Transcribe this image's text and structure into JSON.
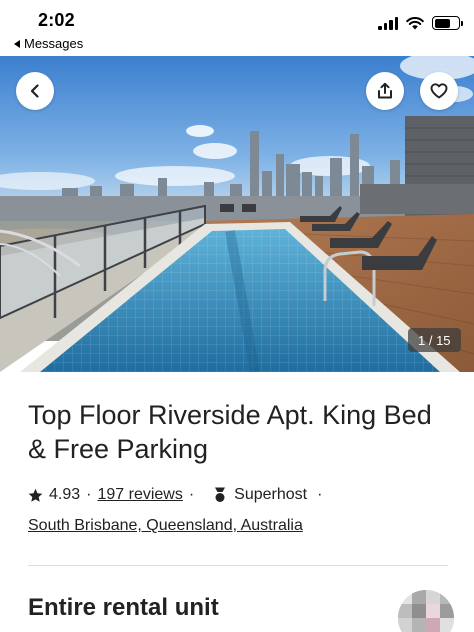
{
  "status_bar": {
    "time": "2:02",
    "back_label": "Messages"
  },
  "gallery": {
    "counter": "1 / 15",
    "image_icon": "rooftop-pool-photo",
    "back_icon": "chevron-left-icon",
    "share_icon": "share-icon",
    "save_icon": "heart-icon"
  },
  "listing": {
    "title": "Top Floor Riverside Apt. King Bed & Free Parking",
    "rating": "4.93",
    "separator": "·",
    "reviews": "197 reviews",
    "badge": "Superhost",
    "trailing_dot": "·",
    "location": "South Brisbane, Queensland, Australia",
    "subtitle": "Entire rental unit"
  },
  "colors": {
    "text": "#222222",
    "divider": "#dddddd",
    "pool": "#2f86b8",
    "sky": "#4a8fd6"
  }
}
